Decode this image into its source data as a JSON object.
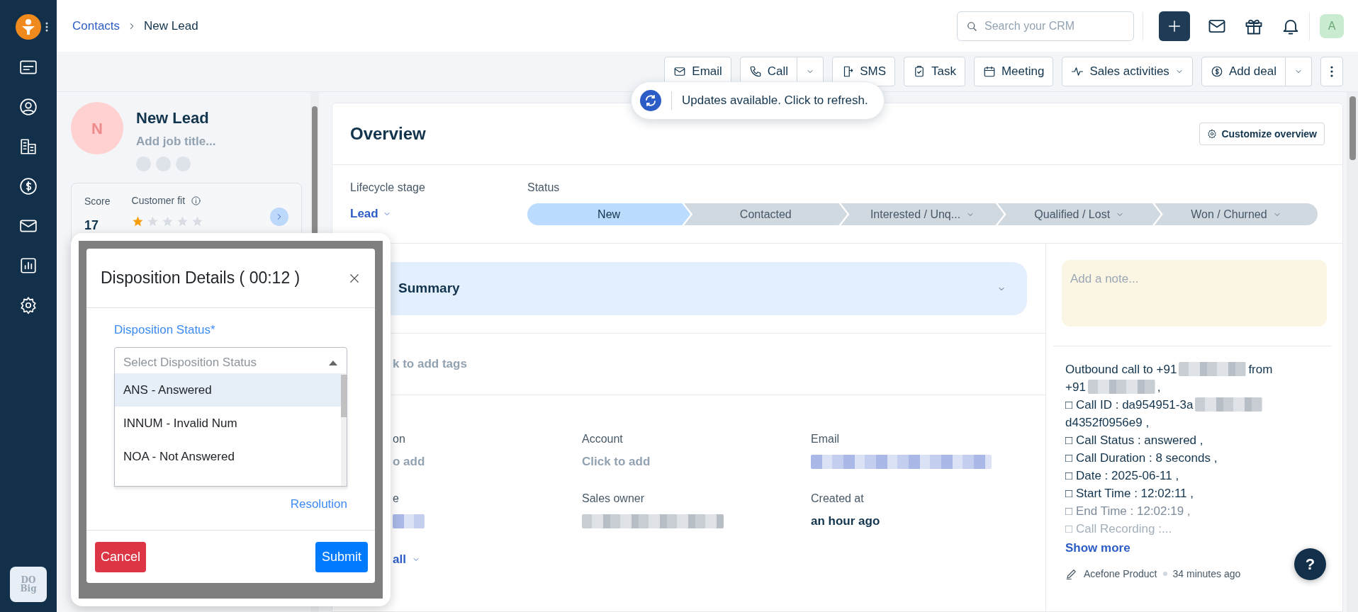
{
  "breadcrumb": {
    "parent": "Contacts",
    "current": "New Lead"
  },
  "search": {
    "placeholder": "Search your CRM"
  },
  "user": {
    "initial": "A"
  },
  "workspace_logo": [
    "DO",
    "Big"
  ],
  "toolbar": [
    {
      "label": "Email",
      "kind": "mail",
      "split": false,
      "menu": false
    },
    {
      "label": "Call",
      "kind": "phone",
      "split": true,
      "menu": false
    },
    {
      "label": "SMS",
      "kind": "sms",
      "split": false,
      "menu": false
    },
    {
      "label": "Task",
      "kind": "task",
      "split": false,
      "menu": false
    },
    {
      "label": "Meeting",
      "kind": "calendar",
      "split": false,
      "menu": false
    },
    {
      "label": "Sales activities",
      "kind": "pulse",
      "split": false,
      "menu": true
    },
    {
      "label": "Add deal",
      "kind": "dollar",
      "split": true,
      "menu": false
    }
  ],
  "toast": {
    "text": "Updates available. Click to refresh."
  },
  "contact": {
    "initial": "N",
    "name": "New Lead",
    "job_placeholder": "Add job title...",
    "score_label": "Score",
    "fit_label": "Customer fit",
    "score": "17",
    "stars": 1
  },
  "overview": {
    "title": "Overview",
    "customize": "Customize overview",
    "lifecycle_label": "Lifecycle stage",
    "lifecycle_value": "Lead",
    "status_label": "Status",
    "stages": [
      {
        "label": "New",
        "selected": true,
        "menu": false
      },
      {
        "label": "Contacted",
        "selected": false,
        "menu": false
      },
      {
        "label": "Interested / Unq...",
        "selected": false,
        "menu": true
      },
      {
        "label": "Qualified / Lost",
        "selected": false,
        "menu": true
      },
      {
        "label": "Won / Churned",
        "selected": false,
        "menu": true
      }
    ],
    "summary": "Summary",
    "tags": "k to add tags",
    "fields": [
      {
        "label": "on",
        "value": "o add",
        "kind": "placeholder"
      },
      {
        "label": "Account",
        "value": "Click to add",
        "kind": "placeholder"
      },
      {
        "label": "Email",
        "kind": "redacted-link"
      },
      {
        "label": "e",
        "kind": "redacted-link"
      },
      {
        "label": "Sales owner",
        "kind": "redacted"
      },
      {
        "label": "Created at",
        "value": "an hour ago",
        "kind": "bold"
      }
    ],
    "view_all": "all"
  },
  "note": {
    "placeholder": "Add a note..."
  },
  "activity": {
    "lines": [
      {
        "text": "Outbound call to +91",
        "redacted": true,
        "after": "from",
        "kind": "normal"
      },
      {
        "text": "+91",
        "redacted": true,
        "after": ",",
        "kind": "normal"
      },
      {
        "text": "□ Call ID : da954951-3a",
        "redacted": true,
        "kind": "normal"
      },
      {
        "text": "d4352f0956e9 ,",
        "redacted": false,
        "kind": "normal"
      },
      {
        "text": "□ Call Status : answered ,",
        "redacted": false,
        "kind": "normal"
      },
      {
        "text": "□ Call Duration : 8 seconds ,",
        "redacted": false,
        "kind": "normal"
      },
      {
        "text": "□ Date : 2025-06-11 ,",
        "redacted": false,
        "kind": "normal"
      },
      {
        "text": "□ Start Time : 12:02:11 ,",
        "redacted": false,
        "kind": "normal"
      },
      {
        "text": "□ End Time : 12:02:19 ,",
        "redacted": false,
        "kind": "muted"
      },
      {
        "text": "□ Call Recording :...",
        "redacted": false,
        "kind": "faint"
      }
    ],
    "show_more": "Show more",
    "author": "Acefone Product",
    "time": "34 minutes ago"
  },
  "modal": {
    "title": "Disposition Details ( 00:12 )",
    "field_label": "Disposition Status*",
    "placeholder": "Select Disposition Status",
    "options": [
      {
        "label": "ANS - Answered",
        "selected": true
      },
      {
        "label": "INNUM - Invalid Num",
        "selected": false
      },
      {
        "label": "NOA - Not Answered",
        "selected": false
      }
    ],
    "resolution": "Resolution",
    "cancel": "Cancel",
    "submit": "Submit"
  },
  "help": "?"
}
